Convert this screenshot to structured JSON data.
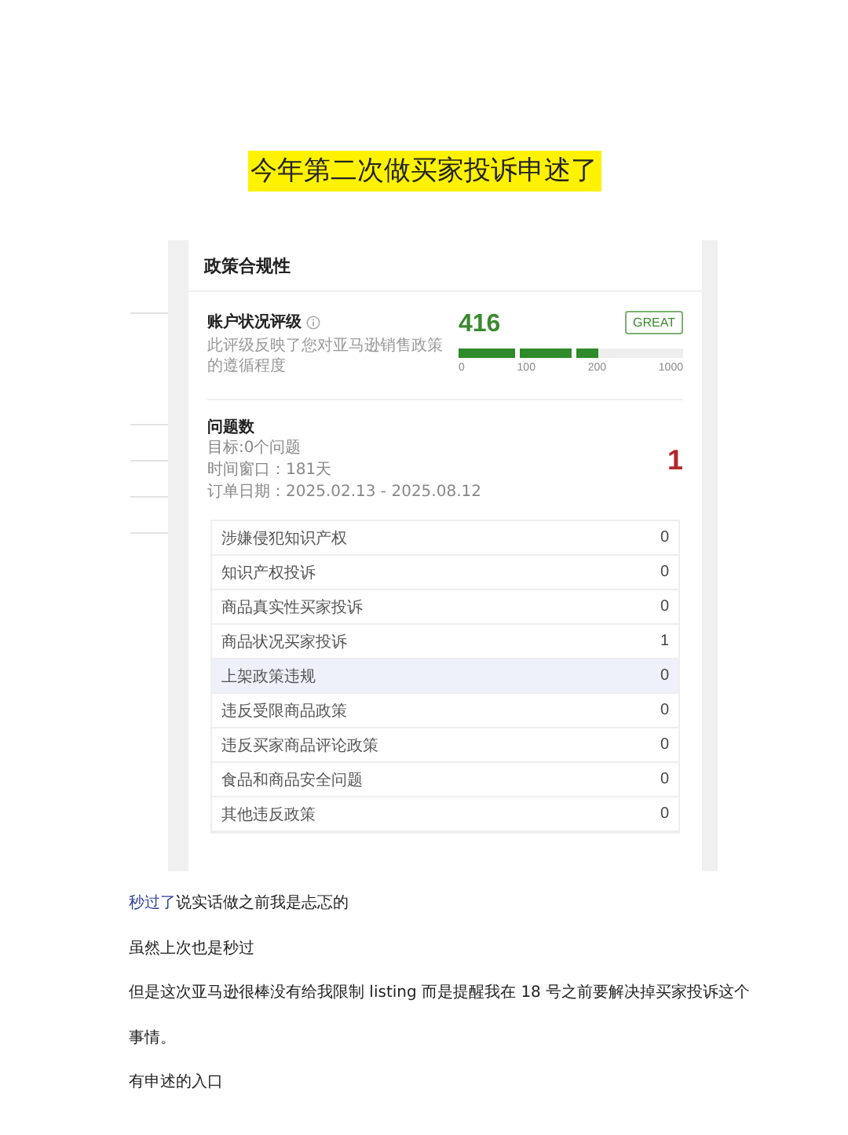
{
  "title": "今年第二次做买家投诉申述了",
  "panel": {
    "heading": "政策合规性",
    "rating": {
      "label": "账户状况评级",
      "description": "此评级反映了您对亚马逊销售政策的遵循程度",
      "score": "416",
      "badge": "GREAT",
      "level": 0.62,
      "ticks": [
        "0",
        "100",
        "200",
        "1000"
      ]
    },
    "issues": {
      "label": "问题数",
      "target": "目标:0个问题",
      "window": "时间窗口：181天",
      "dates": "订单日期：2025.02.13 - 2025.08.12",
      "count": "1"
    },
    "rows": [
      {
        "name": "涉嫌侵犯知识产权",
        "count": "0",
        "selected": false
      },
      {
        "name": "知识产权投诉",
        "count": "0",
        "selected": false
      },
      {
        "name": "商品真实性买家投诉",
        "count": "0",
        "selected": false
      },
      {
        "name": "商品状况买家投诉",
        "count": "1",
        "selected": false
      },
      {
        "name": "上架政策违规",
        "count": "0",
        "selected": true
      },
      {
        "name": "违反受限商品政策",
        "count": "0",
        "selected": false
      },
      {
        "name": "违反买家商品评论政策",
        "count": "0",
        "selected": false
      },
      {
        "name": "食品和商品安全问题",
        "count": "0",
        "selected": false
      },
      {
        "name": "其他违反政策",
        "count": "0",
        "selected": false
      }
    ]
  },
  "paragraphs": [
    {
      "link": "秒过了",
      "text": "说实话做之前我是忐忑的"
    },
    {
      "text": "虽然上次也是秒过"
    },
    {
      "text": "但是这次亚马逊很棒没有给我限制 listing 而是提醒我在 18 号之前要解决掉买家投诉这个"
    },
    {
      "text": "事情。"
    },
    {
      "text": "有申述的入口"
    }
  ]
}
